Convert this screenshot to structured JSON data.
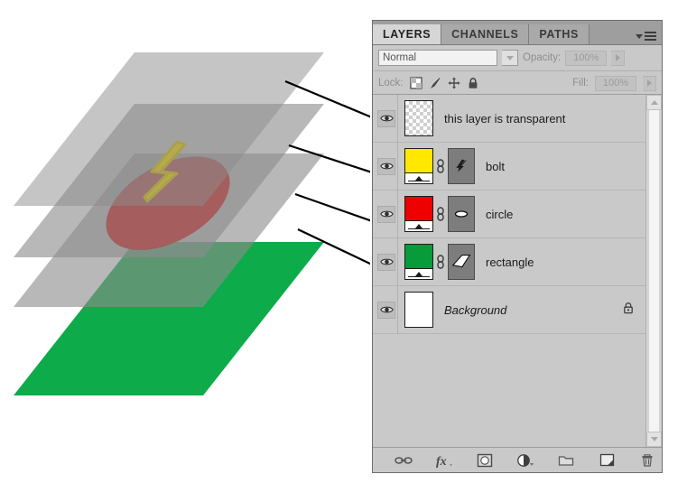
{
  "panel": {
    "tabs": [
      {
        "label": "LAYERS",
        "active": true
      },
      {
        "label": "CHANNELS",
        "active": false
      },
      {
        "label": "PATHS",
        "active": false
      }
    ],
    "menu_icon": "panel-menu-icon",
    "blend_mode": {
      "value": "Normal",
      "dropdown_icon": "chevron-down-icon"
    },
    "opacity": {
      "label": "Opacity:",
      "value": "100%",
      "stepper_icon": "chevron-right-icon"
    },
    "fill": {
      "label": "Fill:",
      "value": "100%",
      "stepper_icon": "chevron-right-icon"
    },
    "lock": {
      "label": "Lock:",
      "icons": [
        "lock-transparency-icon",
        "lock-image-pixels-brush-icon",
        "lock-position-move-icon",
        "lock-all-padlock-icon"
      ]
    },
    "layers": [
      {
        "name": "this layer is transparent",
        "visible": true,
        "eye_icon": "eye-visibility-icon",
        "thumb_type": "checkerboard",
        "thumb_color": "",
        "has_mask": false,
        "has_link": false,
        "italic": false,
        "locked": false
      },
      {
        "name": "bolt",
        "visible": true,
        "eye_icon": "eye-visibility-icon",
        "thumb_type": "color-strip",
        "thumb_color": "#ffe800",
        "has_mask": true,
        "mask_shape": "bolt",
        "has_link": true,
        "link_icon": "layer-mask-link-icon",
        "italic": false,
        "locked": false
      },
      {
        "name": "circle",
        "visible": true,
        "eye_icon": "eye-visibility-icon",
        "thumb_type": "color-strip",
        "thumb_color": "#ee0000",
        "has_mask": true,
        "mask_shape": "circle",
        "has_link": true,
        "link_icon": "layer-mask-link-icon",
        "italic": false,
        "locked": false
      },
      {
        "name": "rectangle",
        "visible": true,
        "eye_icon": "eye-visibility-icon",
        "thumb_type": "color-strip",
        "thumb_color": "#089b3a",
        "has_mask": true,
        "mask_shape": "rectangle",
        "has_link": true,
        "link_icon": "layer-mask-link-icon",
        "italic": false,
        "locked": false
      },
      {
        "name": "Background",
        "visible": true,
        "eye_icon": "eye-visibility-icon",
        "thumb_type": "solid",
        "thumb_color": "#ffffff",
        "has_mask": false,
        "has_link": false,
        "italic": true,
        "locked": true,
        "lock_icon": "padlock-icon"
      }
    ],
    "scrollbar": {
      "up_icon": "chevron-up-icon",
      "down_icon": "chevron-down-icon"
    },
    "footer_buttons": [
      {
        "name": "link-layers-icon",
        "label": ""
      },
      {
        "name": "layer-style-fx-icon",
        "label": "fx"
      },
      {
        "name": "add-layer-mask-icon",
        "label": ""
      },
      {
        "name": "new-adjustment-layer-icon",
        "label": ""
      },
      {
        "name": "new-group-folder-icon",
        "label": ""
      },
      {
        "name": "new-layer-icon",
        "label": ""
      },
      {
        "name": "delete-layer-trash-icon",
        "label": ""
      }
    ]
  },
  "illustration": {
    "description": "stacked transparent layer planes diagram",
    "planes": [
      {
        "name": "transparent-plane",
        "color": "#9a9a9a"
      },
      {
        "name": "bolt-plane",
        "color": "#9a9a9a",
        "shape": "lightning-bolt",
        "shape_color": "#e8d010"
      },
      {
        "name": "circle-plane",
        "color": "#9a9a9a",
        "shape": "ellipse",
        "shape_color": "#cc1111"
      },
      {
        "name": "rectangle-plane",
        "color": "#00a63f",
        "shape": "rectangle",
        "shape_color": "#00a63f"
      }
    ],
    "connector_count": 4
  },
  "colors": {
    "panel_bg": "#c9c9c9",
    "tab_active": "#d6d6d6",
    "tab_inactive": "#a9a9a9",
    "row_border": "#b6b6b6",
    "green": "#089b3a",
    "red": "#ee0000",
    "yellow": "#ffe800"
  }
}
